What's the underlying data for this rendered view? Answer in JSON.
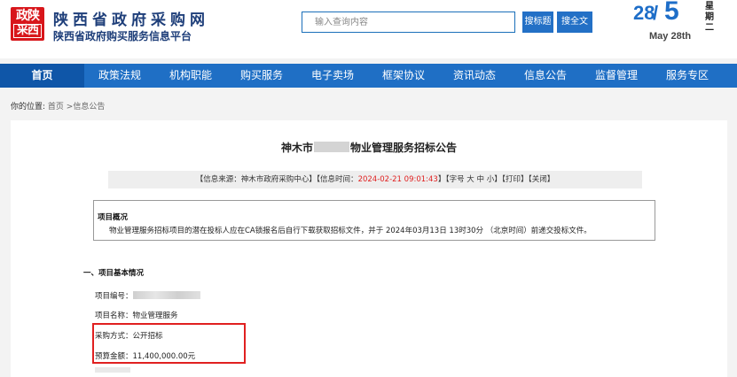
{
  "logo": {
    "line1": "政陕",
    "line2": "采西"
  },
  "site": {
    "title": "陕西省政府采购网",
    "subtitle": "陕西省政府购买服务信息平台"
  },
  "search": {
    "placeholder": "输入查询内容",
    "btn_title": "搜标题",
    "btn_full": "搜全文"
  },
  "date": {
    "day": "28",
    "slash": "/",
    "month": "5",
    "english": "May 28th",
    "weekday": [
      "星",
      "期",
      "二"
    ]
  },
  "nav": {
    "items": [
      "首页",
      "政策法规",
      "机构职能",
      "购买服务",
      "电子卖场",
      "框架协议",
      "资讯动态",
      "信息公告",
      "监督管理",
      "服务专区"
    ],
    "active_index": 0
  },
  "breadcrumb": {
    "label": "你的位置:",
    "path": "首页 >信息公告"
  },
  "doc": {
    "title_prefix": "神木市",
    "title_suffix": "物业管理服务招标公告",
    "info_bar": {
      "source": "【信息来源：神木市政府采购中心】【信息时间：",
      "time": "2024-02-21 09:01:43",
      "tail": "】【字号 大 中 小】【打印】【关闭】"
    },
    "overview": {
      "title": "项目概况",
      "text": "物业管理服务招标项目的潜在投标人应在CA锁报名后自行下载获取招标文件，并于 2024年03月13日 13时30分 （北京时间）前递交投标文件。"
    },
    "section1_title": "一、项目基本情况",
    "fields": {
      "number_label": "项目编号：",
      "name": "项目名称：物业管理服务",
      "method": "采购方式：公开招标",
      "budget": "预算金额：11,400,000.00元"
    }
  },
  "colors": {
    "nav_bg": "#1f6fc5",
    "nav_active": "#0f56a8",
    "accent_red": "#e02020",
    "title_blue": "#1f3f7a"
  }
}
